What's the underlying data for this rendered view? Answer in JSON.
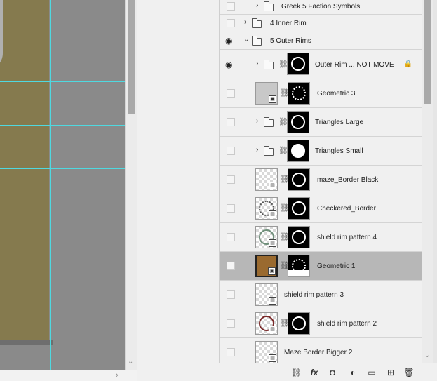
{
  "layers_panel": {
    "rows": [
      {
        "name": "Greek 5 Faction Symbols",
        "type": "group",
        "visible": false
      },
      {
        "name": "4 Inner Rim",
        "type": "group",
        "visible": false
      },
      {
        "name": "5 Outer Rims",
        "type": "group",
        "visible": true,
        "expanded": true
      },
      {
        "name": "Outer Rim ... NOT MOVE",
        "type": "group-masked",
        "visible": true,
        "locked": true
      },
      {
        "name": "Geometric 3",
        "type": "smart-object-masked",
        "visible": false
      },
      {
        "name": "Triangles Large",
        "type": "group-masked",
        "visible": false
      },
      {
        "name": "Triangles Small",
        "type": "group-masked",
        "visible": false
      },
      {
        "name": "maze_Border Black",
        "type": "layer-masked",
        "visible": false
      },
      {
        "name": "Checkered_Border",
        "type": "layer-masked",
        "visible": false
      },
      {
        "name": "shield rim pattern 4",
        "type": "layer-masked",
        "visible": false
      },
      {
        "name": "Geometric 1",
        "type": "smart-object-masked",
        "visible": false,
        "selected": true
      },
      {
        "name": "shield rim pattern 3",
        "type": "layer",
        "visible": false
      },
      {
        "name": "shield rim pattern 2",
        "type": "layer-masked",
        "visible": false
      },
      {
        "name": "Maze Border Bigger 2",
        "type": "layer",
        "visible": false
      }
    ],
    "lock_icon": "lock-icon",
    "eye_icon": "eye-icon"
  },
  "footer_buttons": [
    {
      "icon": "link-layers-icon",
      "glyph": "⛓"
    },
    {
      "icon": "fx-icon",
      "glyph": "fx"
    },
    {
      "icon": "add-mask-icon",
      "glyph": "◘"
    },
    {
      "icon": "adjustment-layer-icon",
      "glyph": "◐"
    },
    {
      "icon": "new-group-icon",
      "glyph": "▭"
    },
    {
      "icon": "new-layer-icon",
      "glyph": "⊞"
    },
    {
      "icon": "delete-icon",
      "glyph": "🗑"
    }
  ],
  "colors": {
    "canvas_art": "#857a4e",
    "guides": "#4fd9e0",
    "selected_row": "#b7b7b7"
  }
}
